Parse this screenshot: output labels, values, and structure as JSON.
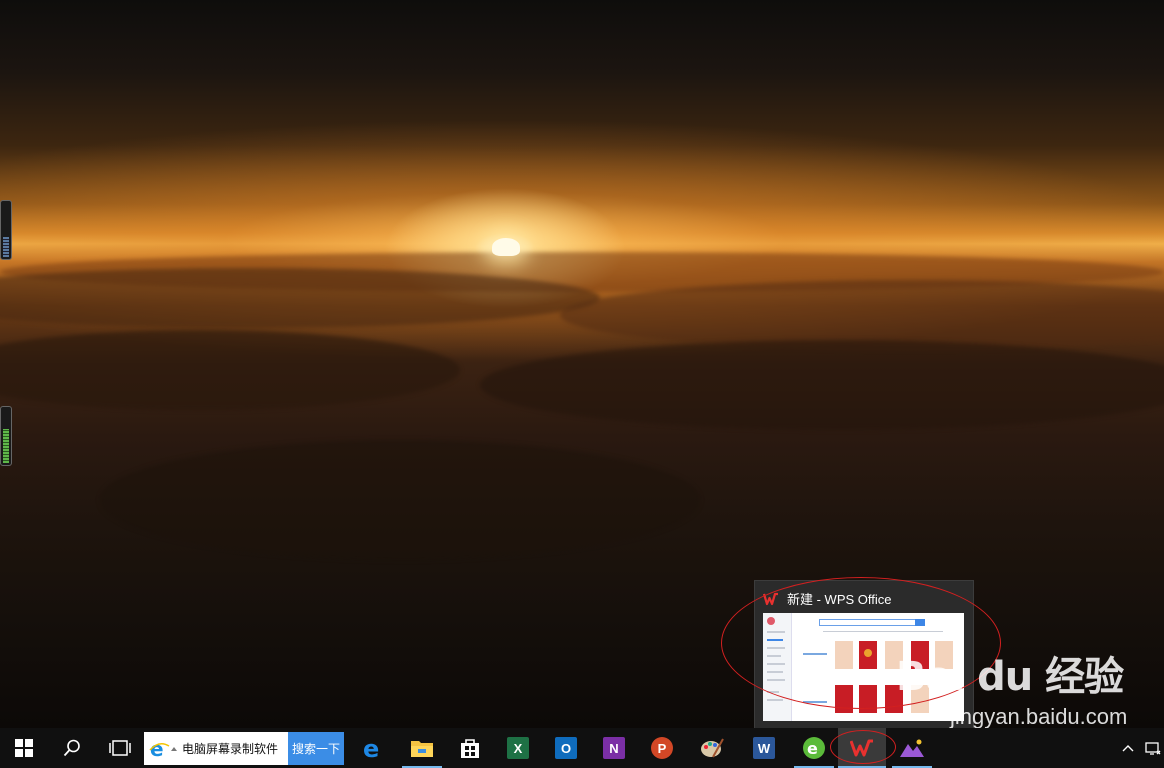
{
  "thumbnail": {
    "title": "新建 - WPS Office"
  },
  "watermark": {
    "brand": "Bai du 经验",
    "url": "jingyan.baidu.com"
  },
  "taskbar": {
    "search": {
      "text": "电脑屏幕录制软件",
      "button_label": "搜索一下"
    },
    "apps": [
      {
        "icon": "edge-icon",
        "state": "pinned"
      },
      {
        "icon": "file-explorer-icon",
        "state": "running"
      },
      {
        "icon": "store-icon",
        "state": "pinned"
      },
      {
        "icon": "excel-icon",
        "state": "pinned"
      },
      {
        "icon": "outlook-icon",
        "state": "pinned"
      },
      {
        "icon": "onenote-icon",
        "state": "pinned"
      },
      {
        "icon": "powerpoint-icon",
        "state": "pinned"
      },
      {
        "icon": "paint-icon",
        "state": "pinned"
      },
      {
        "icon": "word-icon",
        "state": "pinned"
      },
      {
        "icon": "browser-icon",
        "state": "running"
      },
      {
        "icon": "wps-office-icon",
        "state": "active"
      },
      {
        "icon": "photo-app-icon",
        "state": "running"
      }
    ]
  },
  "colors": {
    "taskbar_bg": "#101010",
    "running_indicator": "#76b9ed",
    "annotation": "#d22020",
    "search_button": "#3b8de6"
  }
}
